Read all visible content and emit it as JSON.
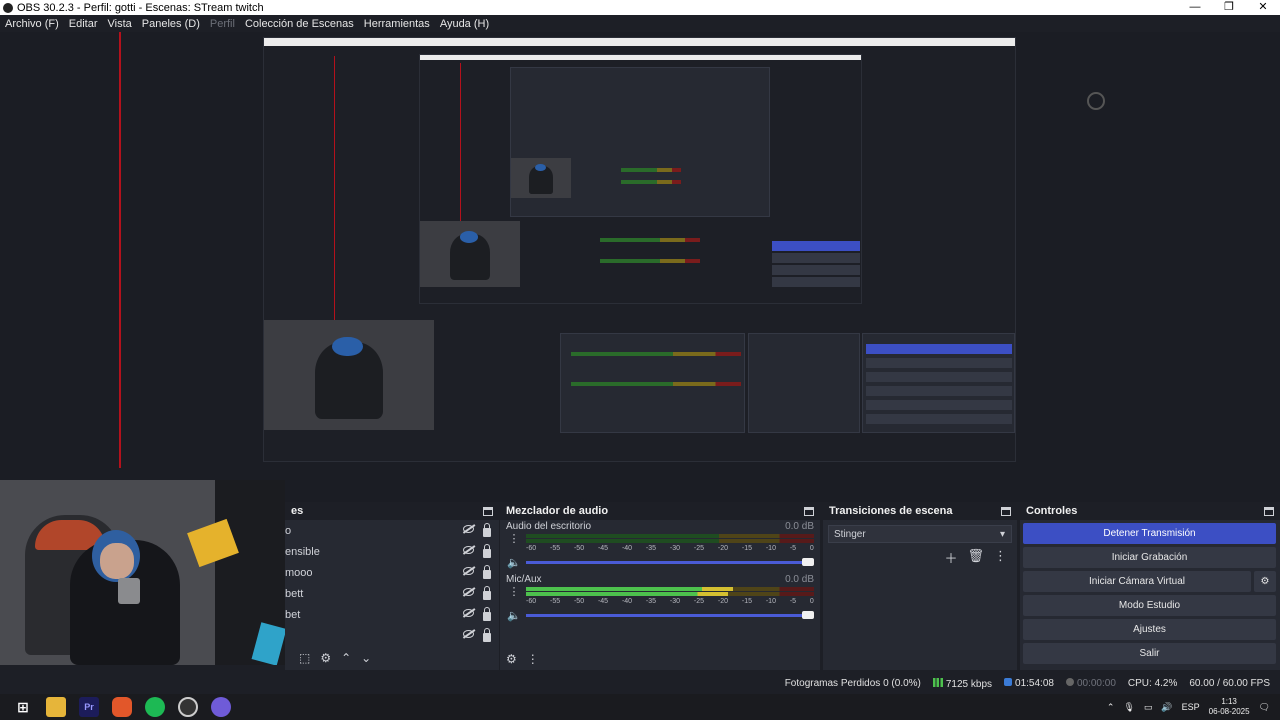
{
  "window": {
    "title": "OBS 30.2.3 - Perfil: gotti - Escenas: STream twitch",
    "minimize": "—",
    "maximize": "❐",
    "close": "✕"
  },
  "menu": [
    "Archivo (F)",
    "Editar",
    "Vista",
    "Paneles (D)",
    "Perfil",
    "Colección de Escenas",
    "Herramientas",
    "Ayuda (H)"
  ],
  "menu_disabled_index": 4,
  "scenes": {
    "title": "es",
    "items": [
      "o",
      "ensible",
      "mooo",
      "bett",
      "bet",
      ""
    ]
  },
  "mixer": {
    "title": "Mezclador de audio",
    "tracks": [
      {
        "name": "Audio del escritorio",
        "db": "0.0 dB",
        "level": 0.0
      },
      {
        "name": "Mic/Aux",
        "db": "0.0 dB",
        "level": 0.72
      }
    ],
    "scale": [
      "-60",
      "-55",
      "-50",
      "-45",
      "-40",
      "-35",
      "-30",
      "-25",
      "-20",
      "-15",
      "-10",
      "-5",
      "0"
    ]
  },
  "transitions": {
    "title": "Transiciones de escena",
    "selected": "Stinger"
  },
  "controls": {
    "title": "Controles",
    "stop_stream": "Detener Transmisión",
    "start_recording": "Iniciar Grabación",
    "start_virtual_cam": "Iniciar Cámara Virtual",
    "studio_mode": "Modo Estudio",
    "settings": "Ajustes",
    "exit": "Salir"
  },
  "status": {
    "dropped": "Fotogramas Perdidos 0 (0.0%)",
    "bitrate": "7125 kbps",
    "stream_time": "01:54:08",
    "rec_time": "00:00:00",
    "cpu": "CPU: 4.2%",
    "fps": "60.00 / 60.00 FPS"
  },
  "taskbar": {
    "premiere": "Pr",
    "lang": "ESP",
    "time": "1:13",
    "date": "06-08-2025"
  },
  "colors": {
    "accent": "#3c4fc4",
    "red_line": "#b3111c",
    "meter_green": "#4dc14d"
  }
}
